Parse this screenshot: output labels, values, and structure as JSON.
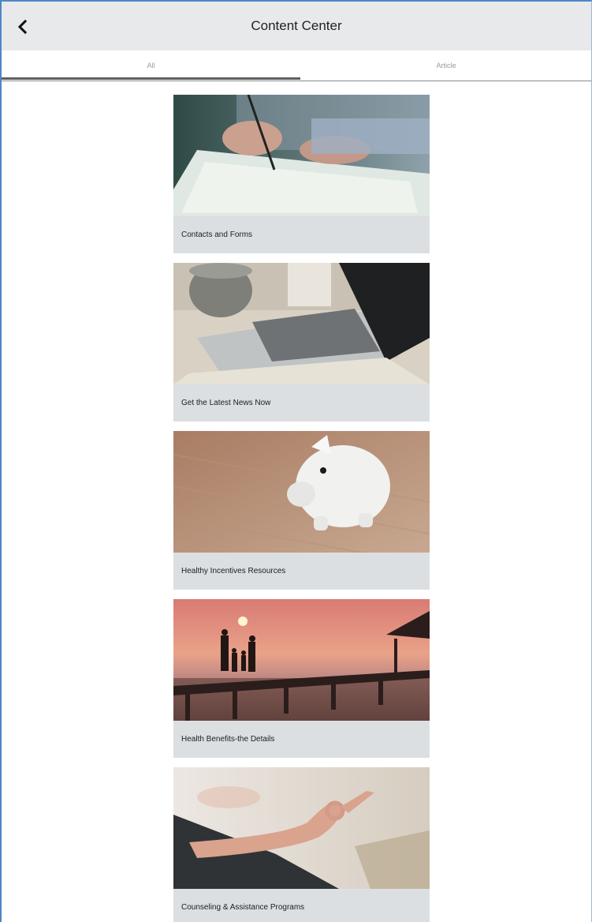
{
  "header": {
    "title": "Content Center"
  },
  "tabs": [
    {
      "label": "All",
      "selected": true
    },
    {
      "label": "Article",
      "selected": false
    }
  ],
  "cards": [
    {
      "caption": "Contacts and Forms",
      "image": "writing-hand-photo"
    },
    {
      "caption": "Get the Latest News Now",
      "image": "laptop-coffee-photo"
    },
    {
      "caption": "Healthy Incentives Resources",
      "image": "piggy-bank-photo"
    },
    {
      "caption": "Health Benefits-the Details",
      "image": "family-pier-sunset-photo"
    },
    {
      "caption": "Counseling & Assistance Programs",
      "image": "meditation-hand-photo"
    }
  ],
  "colors": {
    "header_bg": "#e8e9eb",
    "card_caption_bg": "#dcdfe2",
    "frame_border": "#4f86c6",
    "tab_indicator": "#5f5f5f"
  }
}
